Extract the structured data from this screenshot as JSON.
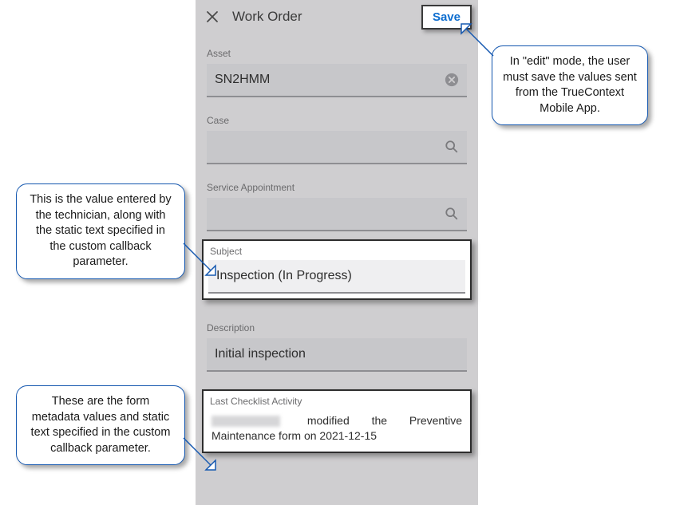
{
  "header": {
    "title": "Work Order",
    "save_label": "Save"
  },
  "fields": {
    "asset": {
      "label": "Asset",
      "value": "SN2HMM"
    },
    "case": {
      "label": "Case",
      "value": ""
    },
    "service_appointment": {
      "label": "Service Appointment",
      "value": ""
    },
    "subject": {
      "label": "Subject",
      "value": "Inspection  (In Progress)"
    },
    "description": {
      "label": "Description",
      "value": "Initial inspection"
    },
    "last_checklist": {
      "label": "Last Checklist Activity",
      "text_after": "modified the Preventive Maintenance form on 2021-12-15"
    }
  },
  "callouts": {
    "save": "In \"edit\" mode, the user must save the values sent from the TrueContext Mobile App.",
    "subject": "This is the value entered by the technician, along with the static text specified in the custom callback parameter.",
    "checklist": "These are the form metadata values and static text specified in the custom callback parameter."
  }
}
